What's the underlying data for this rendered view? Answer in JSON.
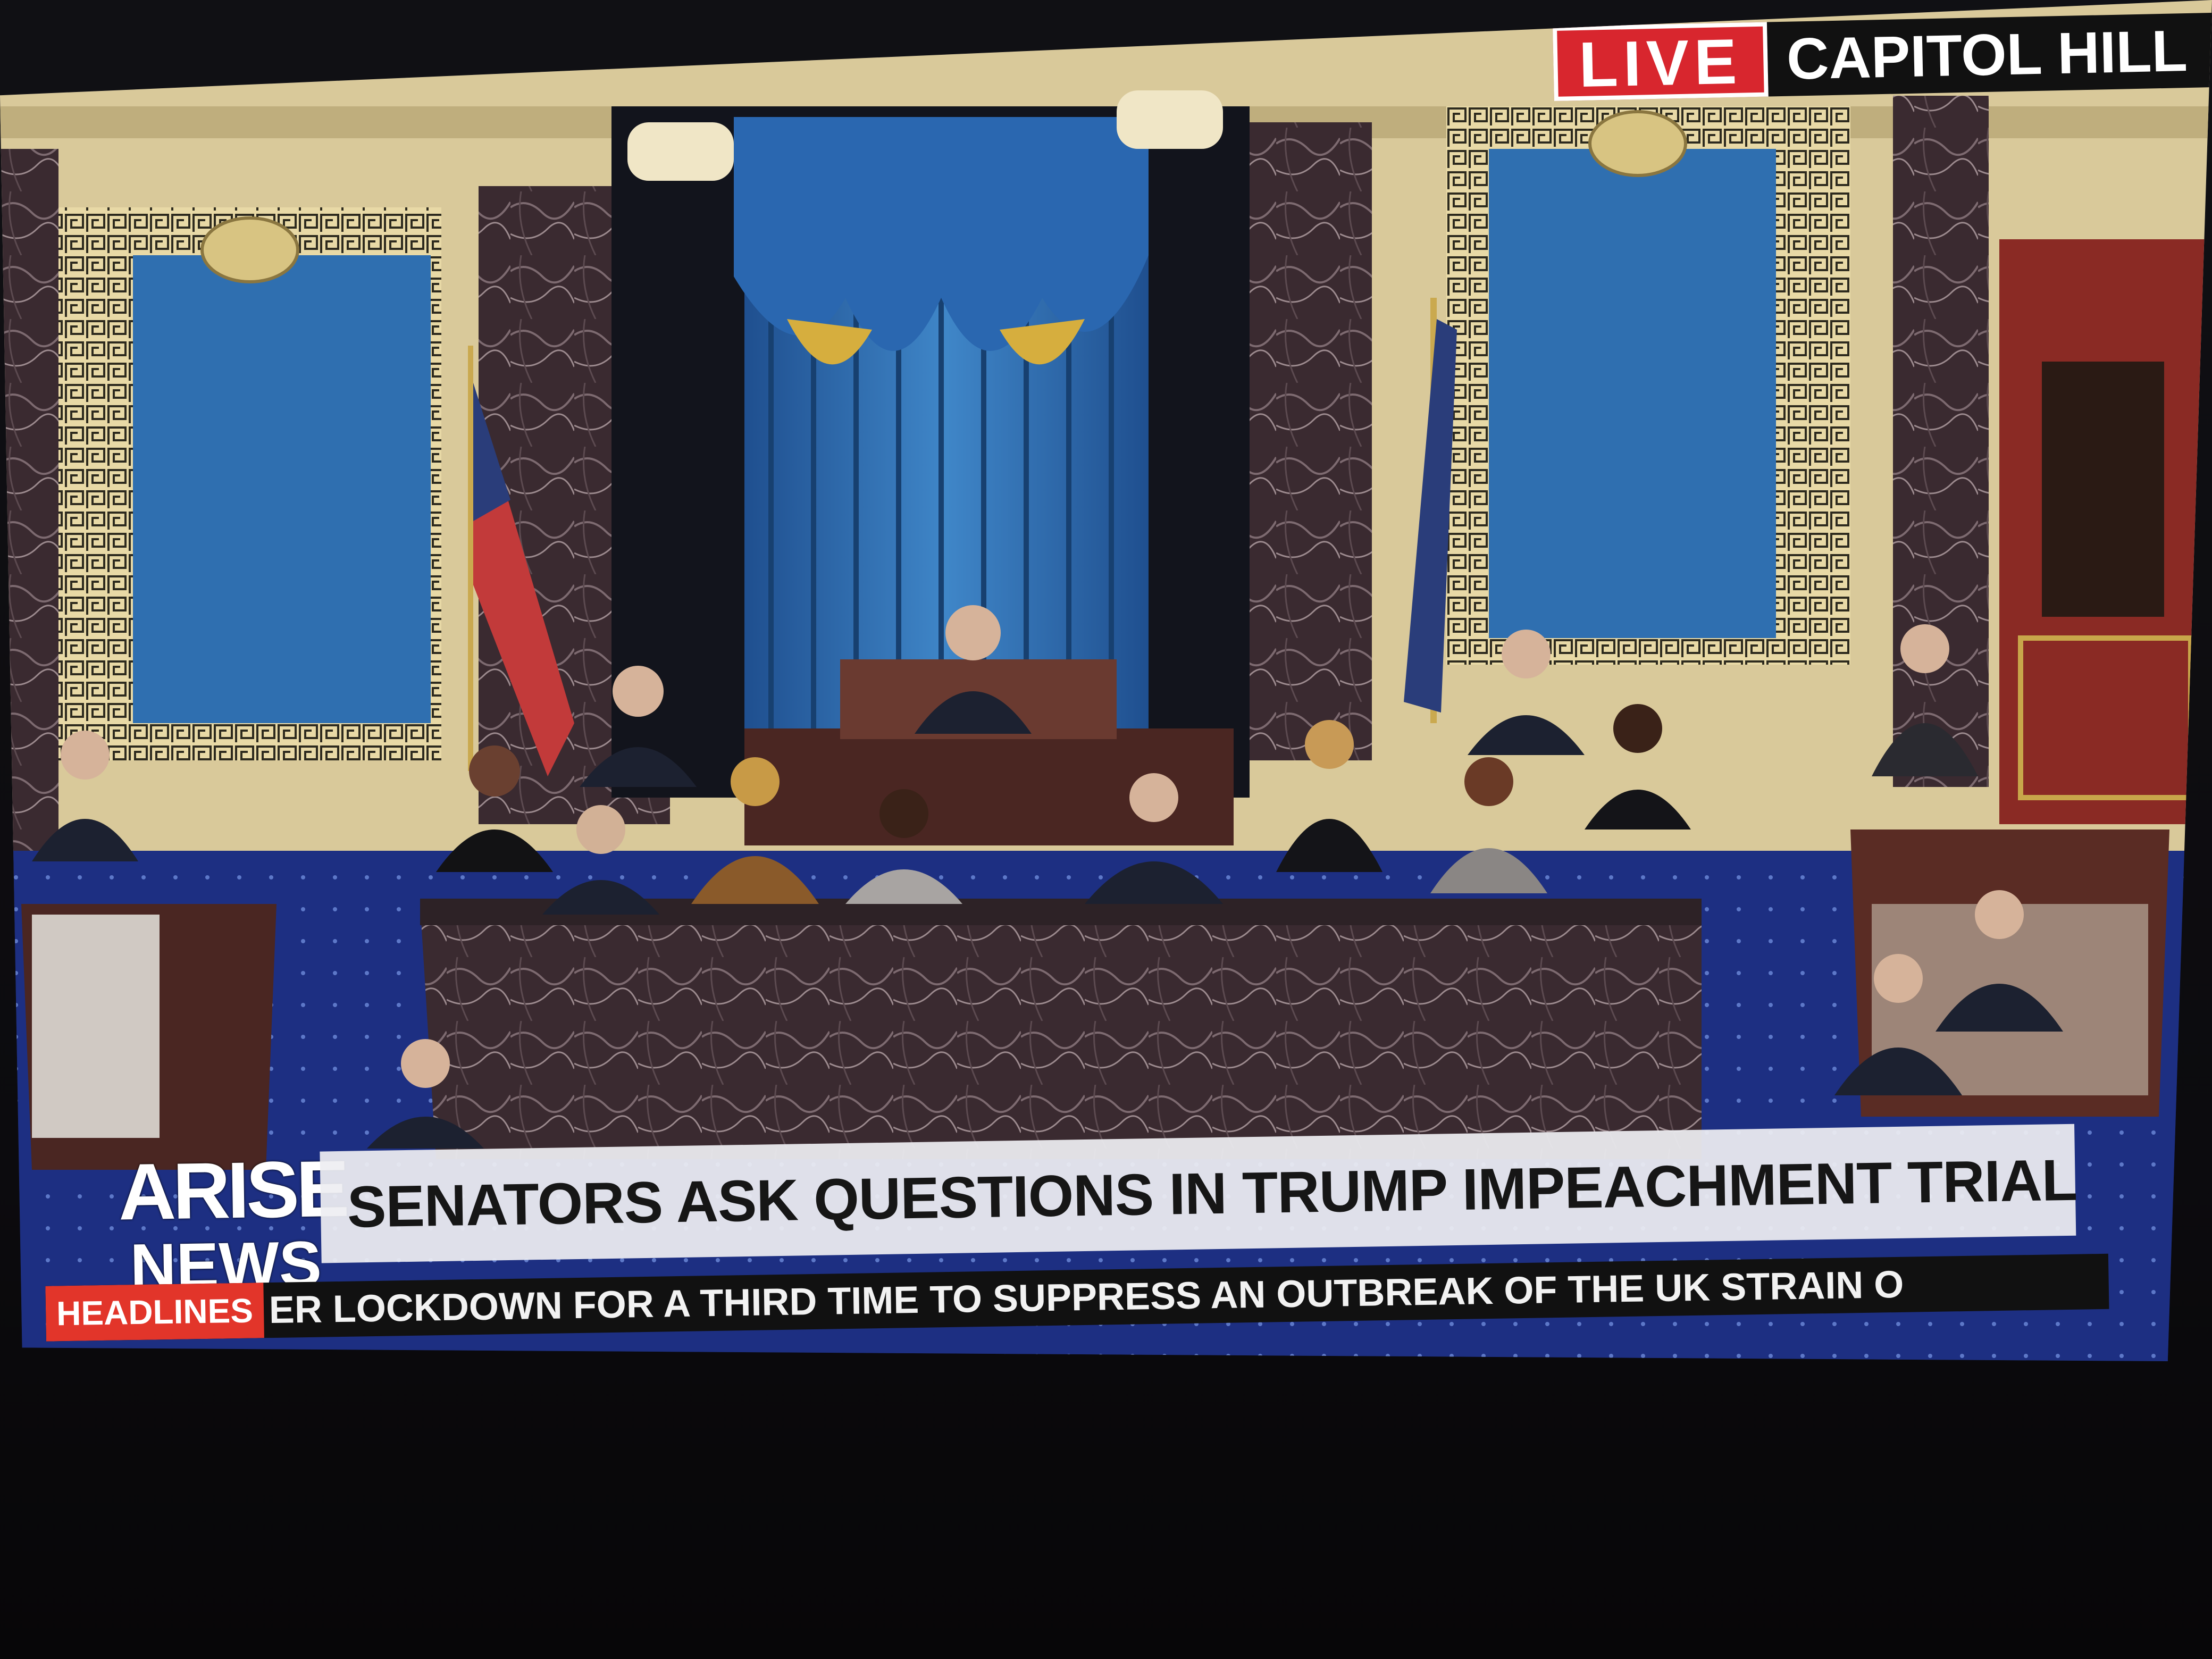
{
  "broadcast": {
    "live_badge": "LIVE",
    "location": "CAPITOL HILL",
    "logo_line1": "ARISE",
    "logo_line2": "NEWS",
    "headline": "SENATORS ASK QUESTIONS IN TRUMP IMPEACHMENT TRIAL",
    "ticker_label": "HEADLINES",
    "ticker_text": "ER LOCKDOWN FOR A THIRD TIME TO SUPPRESS AN OUTBREAK OF THE UK STRAIN O"
  },
  "colors": {
    "live_red": "#d8262e",
    "ticker_red": "#e2352a",
    "chamber_blue": "#2f6fb0",
    "carpet_blue": "#1a2d7a",
    "marble": "#3b2a2f",
    "gold": "#c8a64a"
  }
}
